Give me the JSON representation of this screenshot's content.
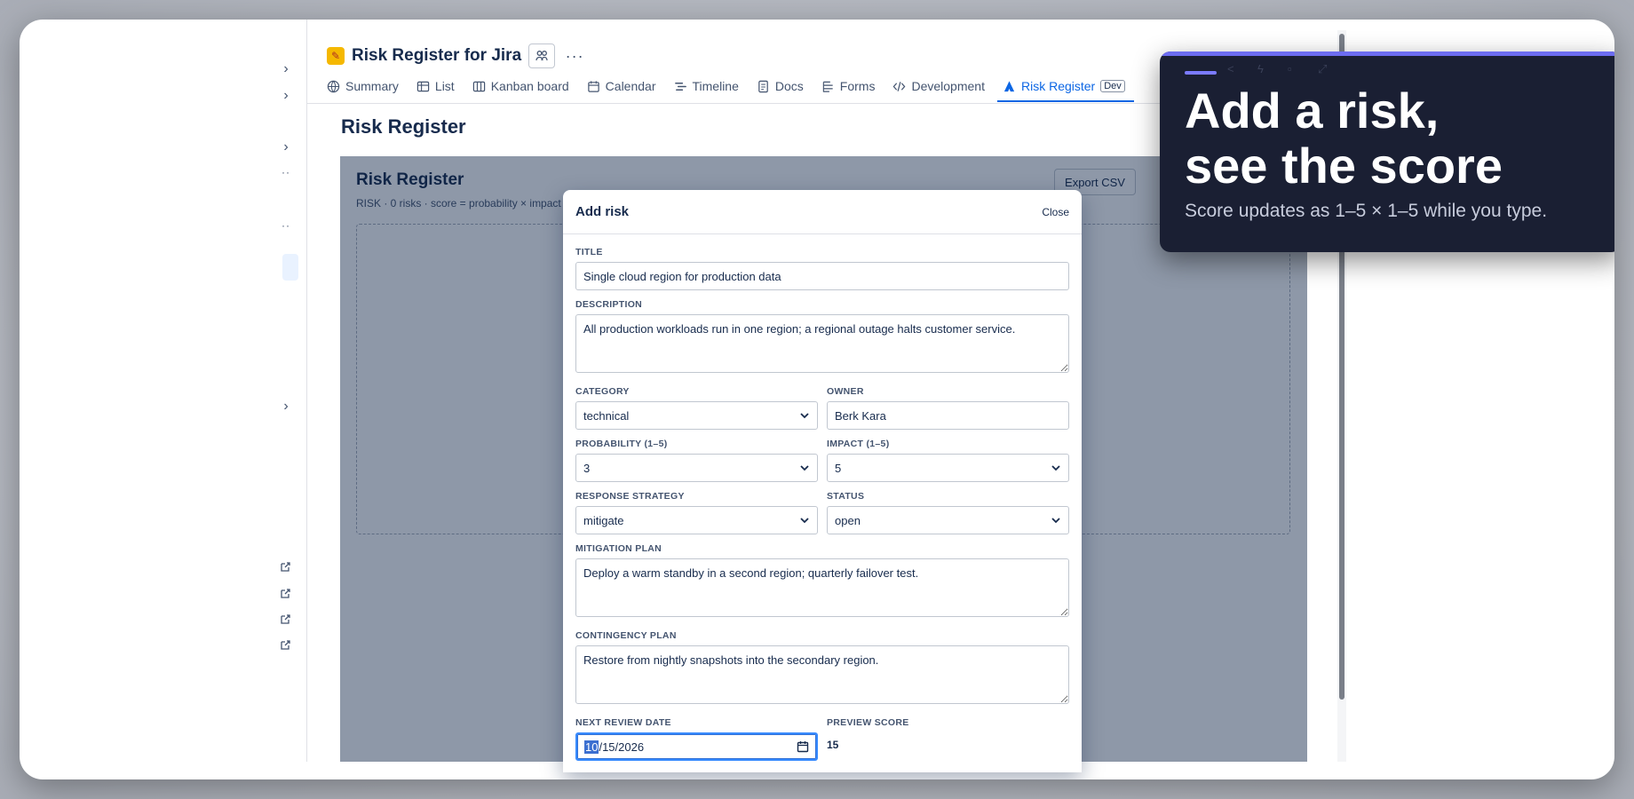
{
  "project": {
    "title": "Risk Register for Jira"
  },
  "tabs": [
    {
      "label": "Summary",
      "icon": "globe-icon"
    },
    {
      "label": "List",
      "icon": "list-icon"
    },
    {
      "label": "Kanban board",
      "icon": "board-icon"
    },
    {
      "label": "Calendar",
      "icon": "calendar-icon"
    },
    {
      "label": "Timeline",
      "icon": "timeline-icon"
    },
    {
      "label": "Docs",
      "icon": "doc-icon"
    },
    {
      "label": "Forms",
      "icon": "form-icon"
    },
    {
      "label": "Development",
      "icon": "code-icon"
    },
    {
      "label": "Risk Register",
      "icon": "app-icon",
      "badge": "Dev",
      "active": true
    }
  ],
  "page": {
    "title": "Risk Register"
  },
  "app": {
    "title": "Risk Register",
    "subtitle": "RISK · 0 risks · score = probability × impact",
    "export_label": "Export CSV"
  },
  "modal": {
    "title": "Add risk",
    "close_label": "Close",
    "fields": {
      "title_label": "Title",
      "title_value": "Single cloud region for production data",
      "description_label": "Description",
      "description_value": "All production workloads run in one region; a regional outage halts customer service.",
      "category_label": "Category",
      "category_value": "technical",
      "owner_label": "Owner",
      "owner_value": "Berk Kara",
      "probability_label": "Probability (1–5)",
      "probability_value": "3",
      "impact_label": "Impact (1–5)",
      "impact_value": "5",
      "response_label": "Response strategy",
      "response_value": "mitigate",
      "status_label": "Status",
      "status_value": "open",
      "mitigation_label": "Mitigation plan",
      "mitigation_value": "Deploy a warm standby in a second region; quarterly failover test.",
      "contingency_label": "Contingency plan",
      "contingency_value": "Restore from nightly snapshots into the secondary region.",
      "review_label": "Next review date",
      "review_month": "10",
      "review_rest": "/15/2026",
      "preview_label": "Preview score",
      "preview_value": "15"
    }
  },
  "tip": {
    "heading_line1": "Add a risk,",
    "heading_line2": "see the score",
    "body": "Score updates as 1–5 × 1–5 while you type."
  },
  "colors": {
    "accent": "#0c66e4",
    "tip_bg": "#1a1f33",
    "tip_bar": "#6c6cf0",
    "overlay": "#8893a8"
  }
}
